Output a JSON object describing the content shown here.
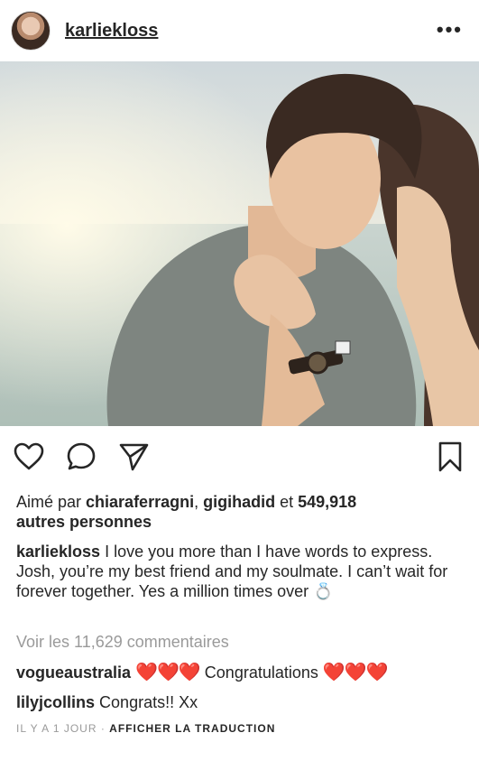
{
  "header": {
    "username": "karliekloss",
    "more_icon": "more-horizontal-icon"
  },
  "photo": {
    "icon": "photo-image"
  },
  "actions": {
    "like_icon": "heart-outline-icon",
    "comment_icon": "comment-bubble-icon",
    "share_icon": "paper-plane-icon",
    "save_icon": "bookmark-icon"
  },
  "likes": {
    "prefix": "Aimé par ",
    "user1": "chiaraferragni",
    "sep": ", ",
    "user2": "gigihadid",
    "mid": " et ",
    "count": "549,918",
    "suffix": "autres personnes"
  },
  "caption": {
    "username": "karliekloss",
    "text": "I love you more than I have words to express. Josh, you’re my best friend and my soulmate. I can’t wait for forever together. Yes a million times over 💍"
  },
  "comments": {
    "view_all": "Voir les 11,629 commentaires",
    "items": [
      {
        "user": "vogueaustralia",
        "pre_emoji": "❤️❤️❤️",
        "text": "Congratulations",
        "post_emoji": "❤️❤️❤️"
      },
      {
        "user": "lilyjcollins",
        "text": "Congrats!! Xx"
      }
    ]
  },
  "meta": {
    "time": "IL Y A 1 JOUR",
    "dot": " · ",
    "translate": "AFFICHER LA TRADUCTION"
  },
  "colors": {
    "text": "#262626",
    "muted": "#9a9a9a",
    "heart": "#e0245e"
  }
}
